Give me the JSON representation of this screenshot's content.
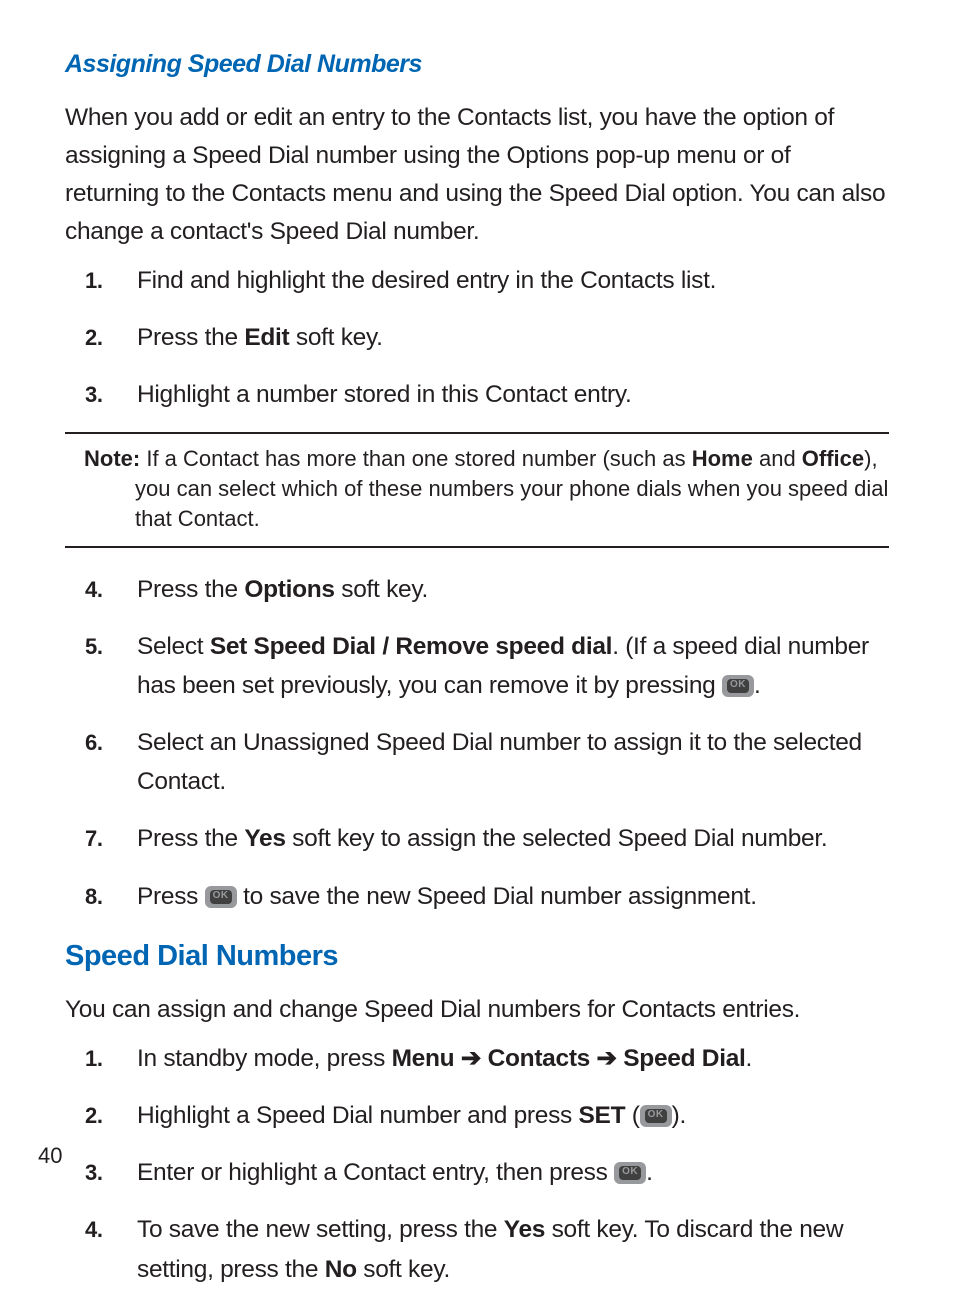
{
  "section1": {
    "title": "Assigning Speed Dial Numbers",
    "intro": "When you add or edit an entry to the Contacts list, you have the option of assigning a Speed Dial number using the Options pop-up menu or of returning to the Contacts menu and using the Speed Dial option. You can also change a contact's Speed Dial number.",
    "steps": {
      "s1": "Find and highlight the desired entry in the Contacts list.",
      "s2_a": "Press the ",
      "s2_b": "Edit",
      "s2_c": " soft key.",
      "s3": "Highlight a number stored in this Contact entry.",
      "s4_a": "Press the ",
      "s4_b": "Options",
      "s4_c": " soft key.",
      "s5_a": "Select ",
      "s5_b": "Set Speed Dial / Remove speed dial",
      "s5_c": ". (If a speed dial number has been set previously, you can remove it by pressing ",
      "s5_d": ".",
      "s6": "Select an Unassigned Speed Dial number to assign it to the selected Contact.",
      "s7_a": "Press the ",
      "s7_b": "Yes",
      "s7_c": " soft key to assign the selected Speed Dial number.",
      "s8_a": "Press ",
      "s8_b": " to save the new Speed Dial number assignment."
    },
    "note": {
      "label": "Note:",
      "a": " If a Contact has more than one stored number (such as ",
      "home": "Home",
      "b": " and ",
      "office": "Office",
      "c": "), you can select which of these numbers your phone dials when you speed dial that Contact."
    }
  },
  "section2": {
    "title": "Speed Dial Numbers",
    "intro": "You can assign and change Speed Dial numbers for Contacts entries.",
    "steps": {
      "s1_a": "In standby mode, press ",
      "s1_menu": "Menu",
      "s1_arr1": " ➔ ",
      "s1_contacts": "Contacts",
      "s1_arr2": " ➔ ",
      "s1_speeddial": "Speed Dial",
      "s1_d": ".",
      "s2_a": "Highlight a Speed Dial number and press ",
      "s2_set": "SET",
      "s2_b": " (",
      "s2_c": ").",
      "s3_a": "Enter or highlight a Contact entry, then press ",
      "s3_b": ".",
      "s4_a": "To save the new setting, press the ",
      "s4_yes": "Yes",
      "s4_b": " soft key. To discard the new setting, press the ",
      "s4_no": "No",
      "s4_c": " soft key."
    }
  },
  "pageNumber": "40",
  "nums": {
    "n1": "1.",
    "n2": "2.",
    "n3": "3.",
    "n4": "4.",
    "n5": "5.",
    "n6": "6.",
    "n7": "7.",
    "n8": "8."
  }
}
